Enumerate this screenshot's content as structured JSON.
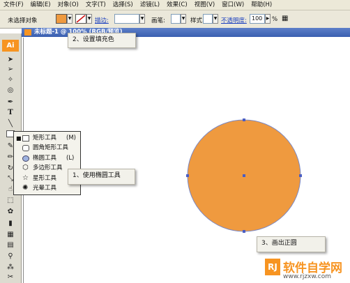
{
  "menu": [
    "文件(F)",
    "编辑(E)",
    "对象(O)",
    "文字(T)",
    "选择(S)",
    "滤镜(L)",
    "效果(C)",
    "视图(V)",
    "窗口(W)",
    "帮助(H)"
  ],
  "control": {
    "selection": "未选择对象",
    "stroke_label": "描边:",
    "brush_label": "画笔:",
    "style_label": "样式:",
    "opacity_label": "不透明度:",
    "opacity_value": "100",
    "percent": "%"
  },
  "colors": {
    "fill": "#ef9a3f",
    "accent": "#f79421"
  },
  "toolbox": {
    "logo": "Ai",
    "tools": [
      "selection-arrow",
      "direct-selection-arrow",
      "magic-wand",
      "lasso",
      "pen",
      "type",
      "line",
      "rectangle",
      "paintbrush",
      "pencil",
      "rotate",
      "scale",
      "warp",
      "free-transform",
      "symbol-sprayer",
      "column-graph",
      "mesh",
      "gradient",
      "eyedropper",
      "blend",
      "scissors",
      "hand"
    ],
    "type_glyph": "T"
  },
  "document": {
    "title": "未标题-1 @ 100% (RGB/预览)"
  },
  "flyout": {
    "items": [
      {
        "label": "矩形工具",
        "shortcut": "(M)",
        "icon": "rectangle-icon"
      },
      {
        "label": "圆角矩形工具",
        "shortcut": "",
        "icon": "rounded-rectangle-icon"
      },
      {
        "label": "椭圆工具",
        "shortcut": "(L)",
        "icon": "ellipse-icon"
      },
      {
        "label": "多边形工具",
        "shortcut": "",
        "icon": "polygon-icon"
      },
      {
        "label": "星形工具",
        "shortcut": "",
        "icon": "star-icon"
      },
      {
        "label": "光晕工具",
        "shortcut": "",
        "icon": "flare-icon"
      }
    ]
  },
  "callouts": {
    "set_fill": "2、设置填充色",
    "use_ellipse": "1、使用椭圆工具",
    "draw_circle": "3、画出正圆"
  },
  "watermark": {
    "brand": "软件自学网",
    "url": "www.rjzxw.com",
    "logo_letters": "RJ"
  }
}
